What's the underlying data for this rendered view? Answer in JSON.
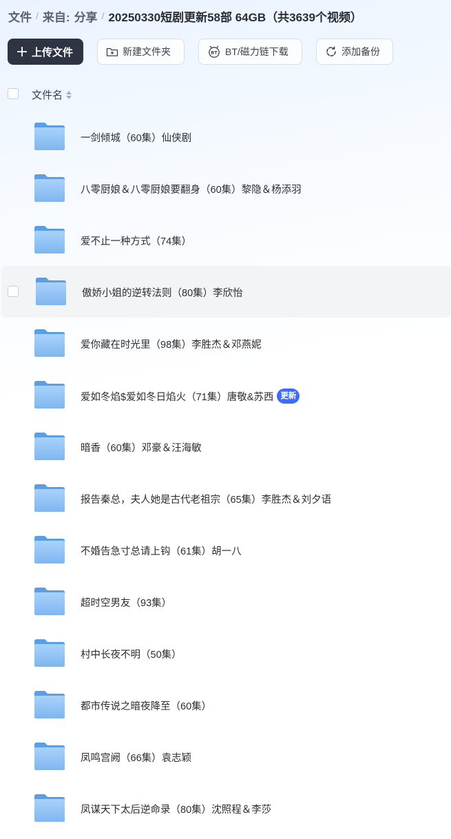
{
  "breadcrumb": {
    "root": "文件",
    "from": "来自:",
    "share": "分享",
    "current": "20250330短剧更新58部 64GB（共3639个视频）"
  },
  "toolbar": {
    "upload_label": "上传文件",
    "new_folder_label": "新建文件夹",
    "bt_label": "BT/磁力链下载",
    "backup_label": "添加备份"
  },
  "list_header": {
    "name_label": "文件名"
  },
  "colors": {
    "primary_button": "#2f3443",
    "badge": "#3f6cf4",
    "folder": "#7fb6f0",
    "hover_row": "#f3f4f6"
  },
  "files": [
    {
      "name": "一剑倾城（60集）仙侠剧",
      "icon": "folder-icon"
    },
    {
      "name": "八零厨娘＆八零厨娘要翻身（60集）黎隐＆杨添羽",
      "icon": "folder-icon"
    },
    {
      "name": "爱不止一种方式（74集）",
      "icon": "folder-icon"
    },
    {
      "name": "傲娇小姐的逆转法则（80集）李欣怡",
      "icon": "folder-icon",
      "hovered": true
    },
    {
      "name": "爱你藏在时光里（98集）李胜杰＆邓燕妮",
      "icon": "folder-icon"
    },
    {
      "name": "爱如冬焰$爱如冬日焰火（71集）唐敬&苏西",
      "icon": "folder-icon",
      "badge": "更新"
    },
    {
      "name": "暗香（60集）邓豪＆汪海敏",
      "icon": "folder-icon"
    },
    {
      "name": "报告秦总，夫人她是古代老祖宗（65集）李胜杰＆刘夕语",
      "icon": "folder-icon"
    },
    {
      "name": "不婚告急寸总请上钩（61集）胡一八",
      "icon": "folder-icon"
    },
    {
      "name": "超时空男友（93集）",
      "icon": "folder-icon"
    },
    {
      "name": "村中长夜不明（50集）",
      "icon": "folder-icon"
    },
    {
      "name": "都市传说之暗夜降至（60集）",
      "icon": "folder-icon"
    },
    {
      "name": "凤鸣宫阙（66集）袁志颖",
      "icon": "folder-icon"
    },
    {
      "name": "凤谋天下太后逆命录（80集）沈照程＆李莎",
      "icon": "folder-icon"
    }
  ]
}
